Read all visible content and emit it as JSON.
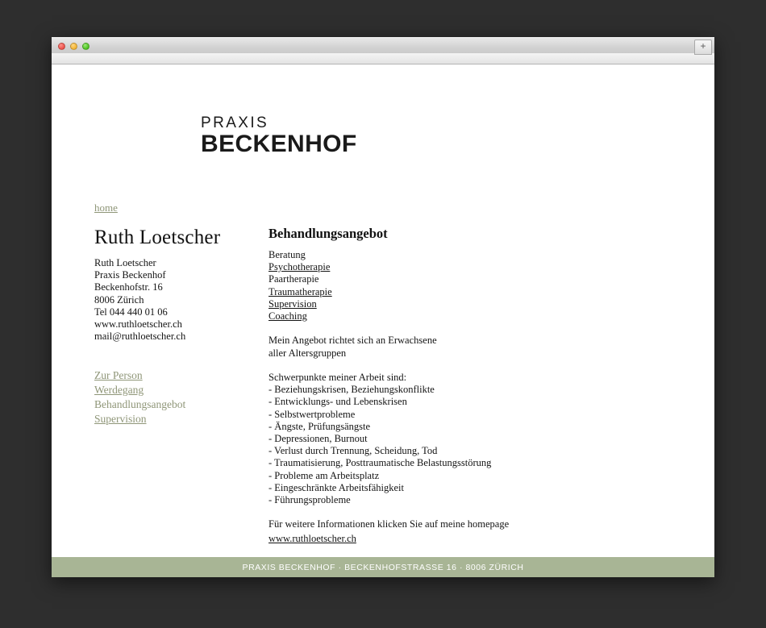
{
  "window": {
    "controls": [
      "close",
      "minimize",
      "zoom"
    ],
    "new_tab_label": "+"
  },
  "site": {
    "logo_top": "PRAXIS",
    "logo_bottom": "BECKENHOF"
  },
  "nav": {
    "home_label": "home"
  },
  "left_column": {
    "heading": "Ruth Loetscher",
    "address": [
      "Ruth Loetscher",
      "Praxis Beckenhof",
      "Beckenhofstr. 16",
      "8006 Zürich",
      "Tel 044 440 01 06",
      "www.ruthloetscher.ch",
      "mail@ruthloetscher.ch"
    ],
    "links": [
      {
        "label": "Zur Person",
        "is_link": true
      },
      {
        "label": "Werdegang",
        "is_link": true
      },
      {
        "label": "Behandlungsangebot",
        "is_link": false
      },
      {
        "label": "Supervision",
        "is_link": true
      }
    ]
  },
  "right_column": {
    "heading": "Behandlungsangebot",
    "services": [
      {
        "label": "Beratung",
        "is_link": false
      },
      {
        "label": "Psychotherapie",
        "is_link": true
      },
      {
        "label": "Paartherapie",
        "is_link": false
      },
      {
        "label": "Traumatherapie",
        "is_link": true
      },
      {
        "label": "Supervision",
        "is_link": true
      },
      {
        "label": "Coaching",
        "is_link": true
      }
    ],
    "intro": [
      "Mein Angebot richtet sich an Erwachsene",
      "aller Altersgruppen"
    ],
    "focus_heading": "Schwerpunkte meiner Arbeit sind:",
    "focus_items": [
      "- Beziehungskrisen, Beziehungskonflikte",
      "- Entwicklungs- und Lebenskrisen",
      "- Selbstwertprobleme",
      "- Ängste, Prüfungsängste",
      "- Depressionen, Burnout",
      "- Verlust durch Trennung, Scheidung, Tod",
      "- Traumatisierung, Posttraumatische Belastungsstörung",
      "- Probleme am Arbeitsplatz",
      "- Eingeschränkte Arbeitsfähigkeit",
      "- Führungsprobleme"
    ],
    "outro": "Für weitere Informationen klicken Sie auf meine homepage",
    "outro_link": "www.ruthloetscher.ch"
  },
  "footer": {
    "text": "PRAXIS BECKENHOF · BECKENHOFSTRASSE 16 · 8006 ZÜRICH",
    "background": "#a8b595"
  },
  "colors": {
    "accent_sage": "#8f9678",
    "text": "#141414",
    "desktop": "#2e2e2e"
  }
}
